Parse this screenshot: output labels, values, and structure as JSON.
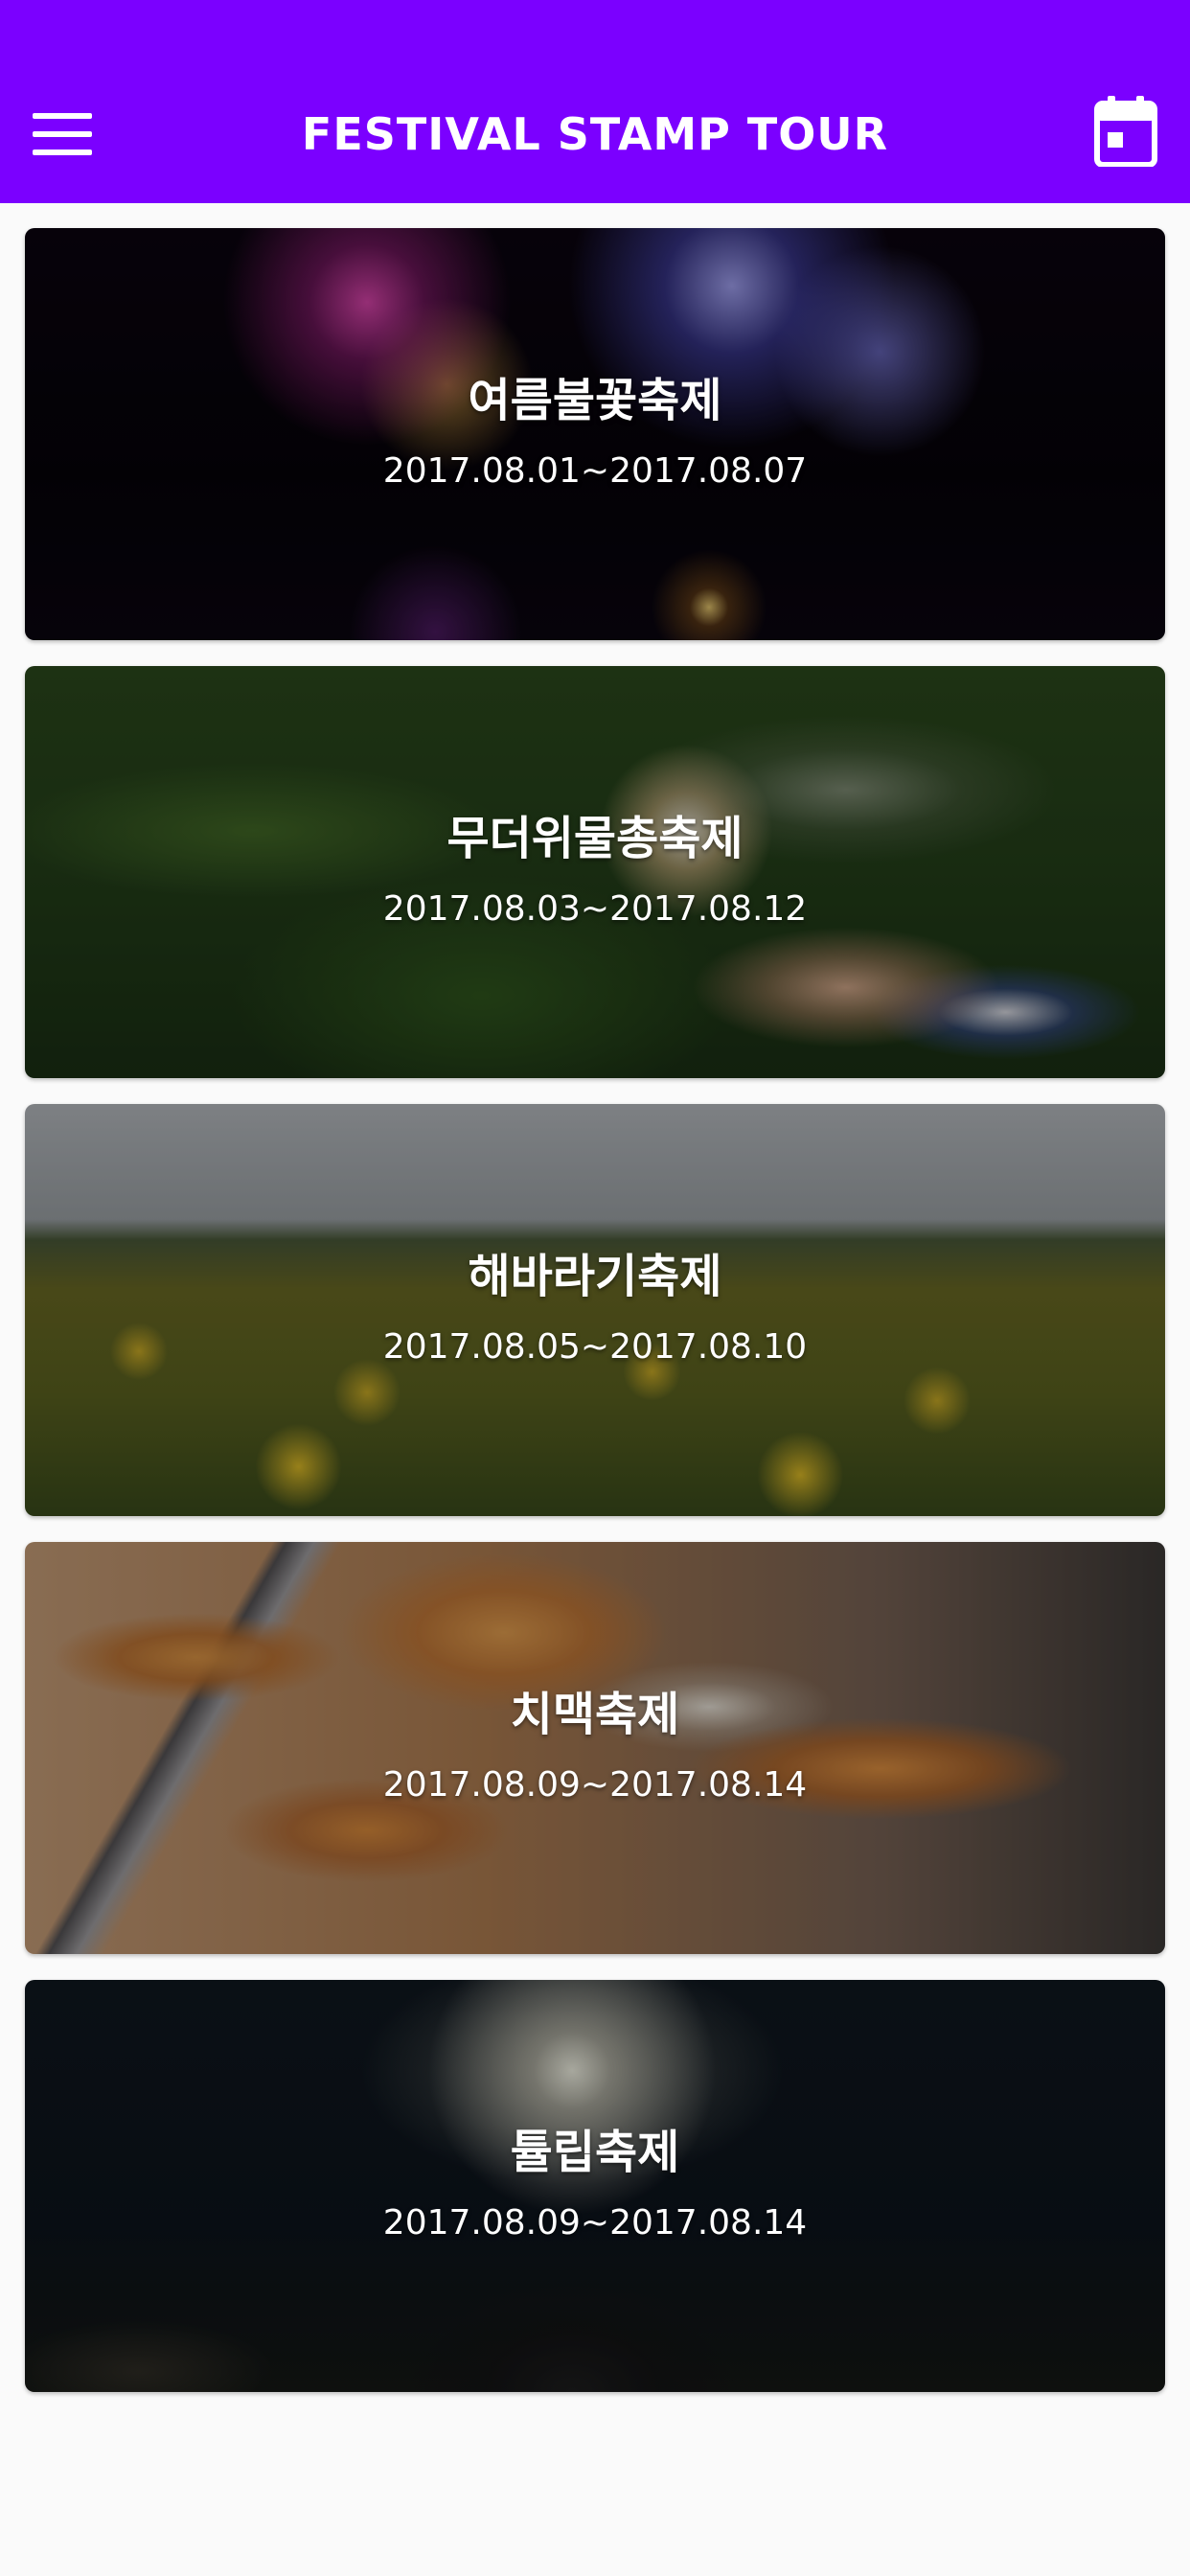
{
  "app_bar": {
    "title": "FESTIVAL STAMP TOUR",
    "background_color": "#7b00ff",
    "menu_icon": "hamburger-menu-icon",
    "calendar_icon": "calendar-icon"
  },
  "festivals": [
    {
      "name": "여름불꽃축제",
      "dates": "2017.08.01~2017.08.07",
      "image": "fireworks-night"
    },
    {
      "name": "무더위물총축제",
      "dates": "2017.08.03~2017.08.12",
      "image": "water-gun"
    },
    {
      "name": "해바라기축제",
      "dates": "2017.08.05~2017.08.10",
      "image": "sunflower-field"
    },
    {
      "name": "치맥축제",
      "dates": "2017.08.09~2017.08.14",
      "image": "fried-chicken"
    },
    {
      "name": "튤립축제",
      "dates": "2017.08.09~2017.08.14",
      "image": "fireworks-crowd"
    }
  ]
}
